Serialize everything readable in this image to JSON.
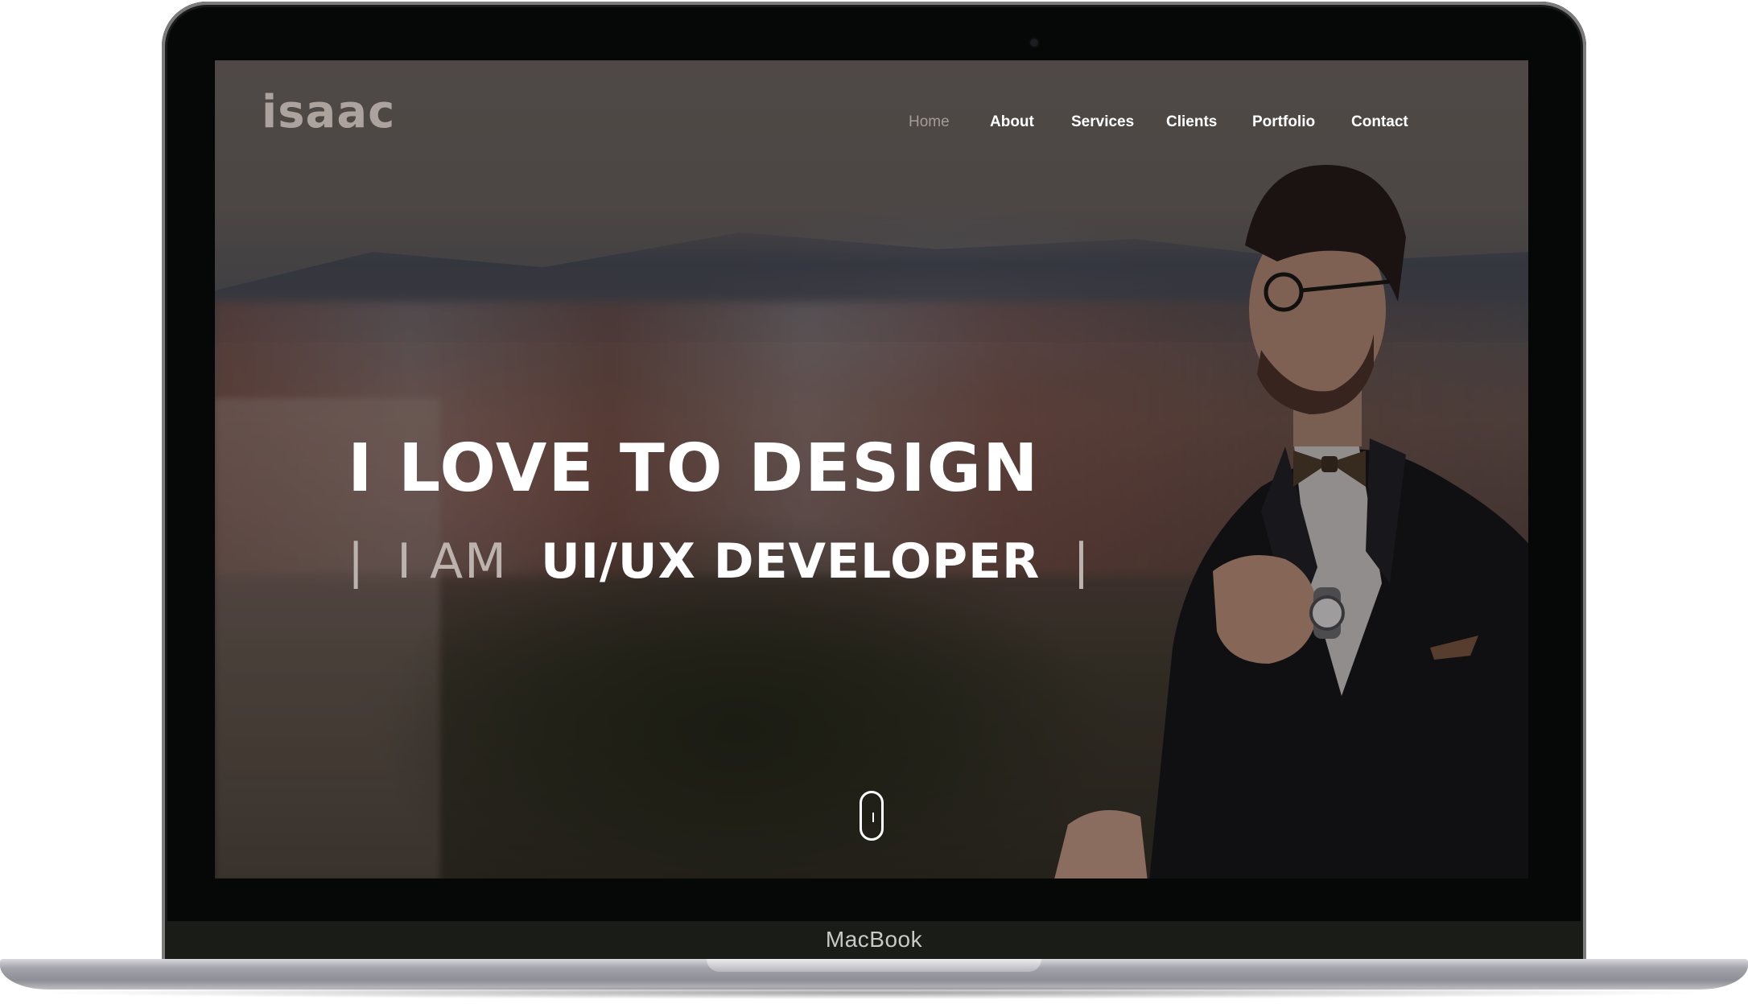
{
  "device": {
    "label": "MacBook"
  },
  "site": {
    "logo": "isaac",
    "nav": [
      {
        "label": "Home",
        "active": true
      },
      {
        "label": "About",
        "active": false
      },
      {
        "label": "Services",
        "active": false
      },
      {
        "label": "Clients",
        "active": false
      },
      {
        "label": "Portfolio",
        "active": false
      },
      {
        "label": "Contact",
        "active": false
      }
    ],
    "hero": {
      "title": "I LOVE TO DESIGN",
      "sub_prefix": "I AM",
      "sub_role": "UI/UX DEVELOPER",
      "cursor_bar": "|",
      "leading_bar": "|"
    },
    "scroll_indicator": "mouse-scroll-icon"
  },
  "colors": {
    "nav_active": "#a59b97",
    "nav_text": "#ffffff",
    "logo": "#bdb3ae",
    "hero_text": "#ffffff"
  }
}
